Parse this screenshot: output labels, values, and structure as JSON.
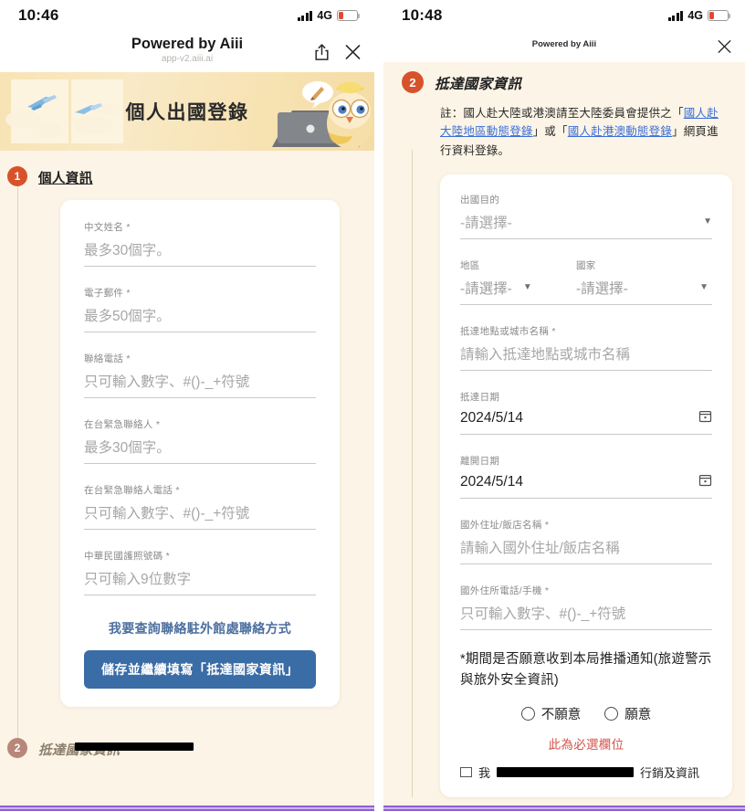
{
  "left": {
    "status": {
      "time": "10:46",
      "network": "4G"
    },
    "chrome": {
      "title": "Powered by Aiii",
      "subtitle": "app-v2.aiii.ai",
      "share_icon": "share-icon",
      "close_icon": "close-icon"
    },
    "banner": {
      "title": "個人出國登錄"
    },
    "step": {
      "number": "1",
      "title": "個人資訊"
    },
    "fields": [
      {
        "label": "中文姓名",
        "required": true,
        "placeholder": "最多30個字。"
      },
      {
        "label": "電子郵件",
        "required": true,
        "placeholder": "最多50個字。"
      },
      {
        "label": "聯絡電話",
        "required": true,
        "placeholder": "只可輸入數字、#()-_+符號"
      },
      {
        "label": "在台緊急聯絡人",
        "required": true,
        "placeholder": "最多30個字。"
      },
      {
        "label": "在台緊急聯絡人電話",
        "required": true,
        "placeholder": "只可輸入數字、#()-_+符號"
      },
      {
        "label": "中華民國護照號碼",
        "required": true,
        "placeholder": "只可輸入9位數字"
      }
    ],
    "link_text": "我要查詢聯絡駐外館處聯絡方式",
    "submit_label": "儲存並繼續填寫「抵達國家資訊」",
    "next_step": {
      "number": "2",
      "title": "抵達國家資訊"
    }
  },
  "right": {
    "status": {
      "time": "10:48",
      "network": "4G"
    },
    "chrome": {
      "title": "Powered by Aiii",
      "close_icon": "close-icon"
    },
    "step": {
      "number": "2",
      "title": "抵達國家資訊"
    },
    "note": {
      "p1": "註：國人赴大陸或港澳請至大陸委員會提供之「",
      "link1": "國人赴大陸地區動態登錄",
      "p2": "」或「",
      "link2": "國人赴港澳動態登錄",
      "p3": "」網頁進行資料登錄。"
    },
    "purpose": {
      "label": "出國目的",
      "value": "-請選擇-"
    },
    "region": {
      "label": "地區",
      "value": "-請選擇-"
    },
    "country": {
      "label": "國家",
      "value": "-請選擇-"
    },
    "arrival_place": {
      "label": "抵達地點或城市名稱",
      "required": true,
      "placeholder": "請輸入抵達地點或城市名稱"
    },
    "arrival_date": {
      "label": "抵達日期",
      "value": "2024/5/14"
    },
    "departure_date": {
      "label": "離開日期",
      "value": "2024/5/14"
    },
    "abroad_address": {
      "label": "國外住址/飯店名稱",
      "required": true,
      "placeholder": "請輸入國外住址/飯店名稱"
    },
    "abroad_phone": {
      "label": "國外住所電話/手機",
      "required": true,
      "placeholder": "只可輸入數字、#()-_+符號"
    },
    "consent": {
      "question": "*期間是否願意收到本局推播通知(旅遊警示與旅外安全資訊)",
      "option_no": "不願意",
      "option_yes": "願意",
      "error": "此為必選欄位"
    },
    "agree_prefix": "我",
    "agree_suffix": "行銷及資訊"
  },
  "colors": {
    "accent_orange": "#d7522a",
    "primary_blue": "#3a6ca5",
    "link_blue": "#3a6fd8",
    "error_red": "#d4524a",
    "page_bg": "#fcf4e6",
    "bottom_bar": "#8f5fd6"
  }
}
